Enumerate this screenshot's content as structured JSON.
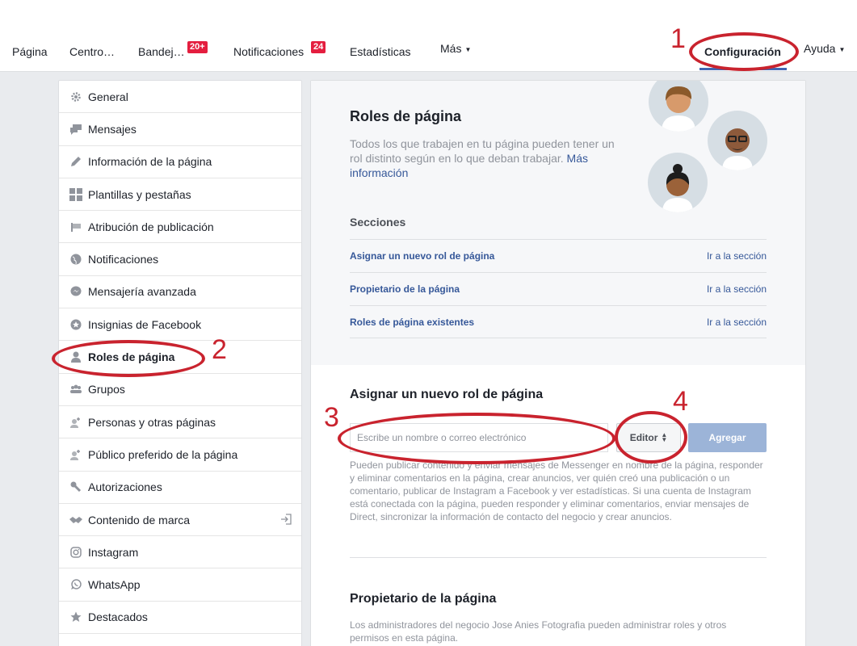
{
  "nav": {
    "items": [
      "Página",
      "Centro…",
      "Bandej…",
      "Notificaciones",
      "Estadísticas",
      "Más"
    ],
    "badges": {
      "inbox": "20+",
      "notifications": "24"
    },
    "settings": "Configuración",
    "help": "Ayuda"
  },
  "sidebar": {
    "items": [
      {
        "label": "General",
        "icon": "gear-icon"
      },
      {
        "label": "Mensajes",
        "icon": "chat-bubbles-icon"
      },
      {
        "label": "Información de la página",
        "icon": "pencil-icon"
      },
      {
        "label": "Plantillas y pestañas",
        "icon": "grid-icon"
      },
      {
        "label": "Atribución de publicación",
        "icon": "flag-icon"
      },
      {
        "label": "Notificaciones",
        "icon": "globe-icon"
      },
      {
        "label": "Mensajería avanzada",
        "icon": "messenger-icon"
      },
      {
        "label": "Insignias de Facebook",
        "icon": "star-badge-icon"
      },
      {
        "label": "Roles de página",
        "icon": "person-icon"
      },
      {
        "label": "Grupos",
        "icon": "group-icon"
      },
      {
        "label": "Personas y otras páginas",
        "icon": "person-add-icon"
      },
      {
        "label": "Público preferido de la página",
        "icon": "person-add-icon"
      },
      {
        "label": "Autorizaciones",
        "icon": "wrench-icon"
      },
      {
        "label": "Contenido de marca",
        "icon": "handshake-icon"
      },
      {
        "label": "Instagram",
        "icon": "instagram-icon"
      },
      {
        "label": "WhatsApp",
        "icon": "whatsapp-icon"
      },
      {
        "label": "Destacados",
        "icon": "star-icon"
      }
    ]
  },
  "roles": {
    "title": "Roles de página",
    "desc": "Todos los que trabajen en tu página pueden tener un rol distinto según en lo que deban trabajar.",
    "more": "Más información",
    "sections_heading": "Secciones",
    "sections": [
      {
        "label": "Asignar un nuevo rol de página",
        "go": "Ir a la sección"
      },
      {
        "label": "Propietario de la página",
        "go": "Ir a la sección"
      },
      {
        "label": "Roles de página existentes",
        "go": "Ir a la sección"
      }
    ]
  },
  "assign": {
    "title": "Asignar un nuevo rol de página",
    "placeholder": "Escribe un nombre o correo electrónico",
    "role": "Editor",
    "add": "Agregar",
    "help": "Pueden publicar contenido y enviar mensajes de Messenger en nombre de la página, responder y eliminar comentarios en la página, crear anuncios, ver quién creó una publicación o un comentario, publicar de Instagram a Facebook y ver estadísticas. Si una cuenta de Instagram está conectada con la página, pueden responder y eliminar comentarios, enviar mensajes de Direct, sincronizar la información de contacto del negocio y crear anuncios."
  },
  "owner": {
    "title": "Propietario de la página",
    "desc": "Los administradores del negocio Jose Anies Fotografia pueden administrar roles y otros permisos en esta página."
  },
  "annotations": [
    "1",
    "2",
    "3",
    "4"
  ],
  "colors": {
    "annotation": "#c9232e",
    "link": "#365899",
    "badge": "#e41e3f"
  }
}
